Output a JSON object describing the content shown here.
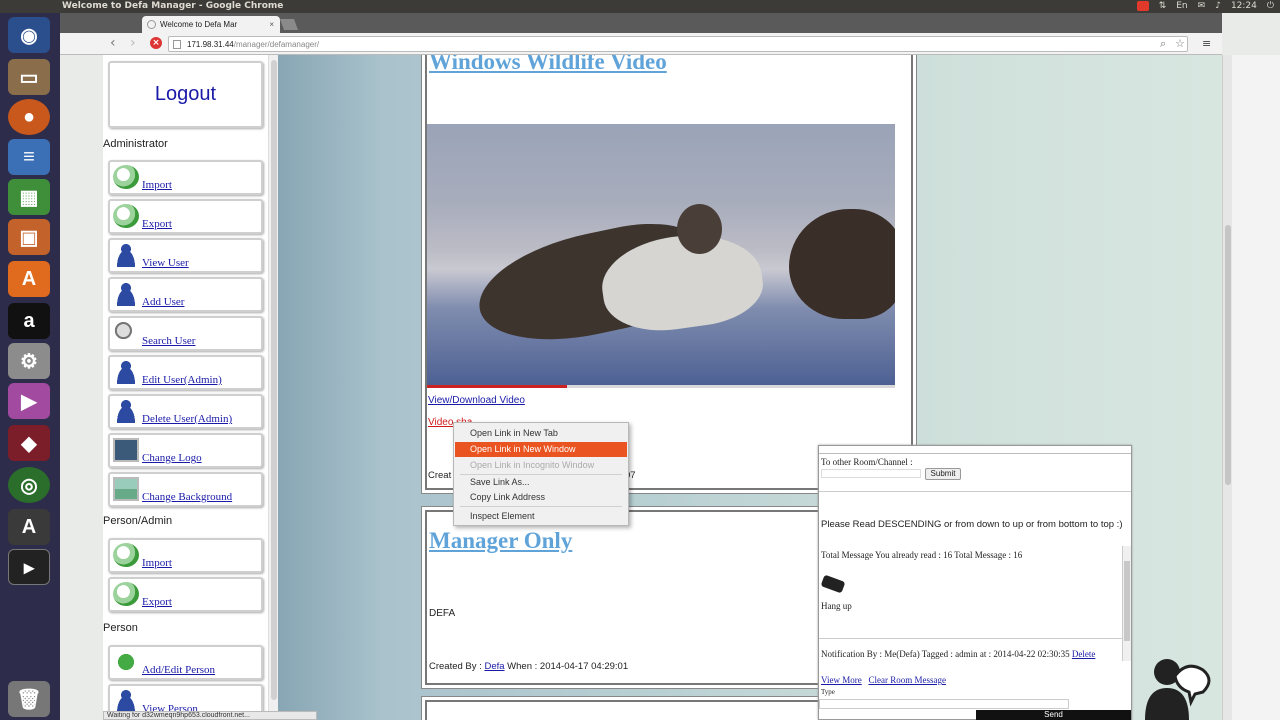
{
  "system": {
    "window_title": "Welcome to Defa Manager - Google Chrome",
    "clock": "12:24",
    "keyboard": "En"
  },
  "browser": {
    "tab_title": "Welcome to Defa Mar",
    "url_host": "171.98.31.44",
    "url_path": "/manager/defamanager/",
    "status_url": "Waiting for d32wmeqn9hp653.cloudfront.net..."
  },
  "sidebar": {
    "logout": "Logout",
    "sections": {
      "administrator": "Administrator",
      "person_admin": "Person/Admin",
      "person": "Person"
    },
    "admin_items": [
      {
        "label": "Import",
        "icon": "import-icon"
      },
      {
        "label": "Export",
        "icon": "export-icon"
      },
      {
        "label": "View User",
        "icon": "user-icon"
      },
      {
        "label": "Add User",
        "icon": "add-user-icon"
      },
      {
        "label": "Search User",
        "icon": "search-user-icon"
      },
      {
        "label": "Edit User(Admin)",
        "icon": "edit-user-icon"
      },
      {
        "label": "Delete User(Admin)",
        "icon": "delete-user-icon"
      },
      {
        "label": "Change Logo",
        "icon": "logo-icon"
      },
      {
        "label": "Change Background",
        "icon": "background-icon"
      }
    ],
    "person_admin_items": [
      {
        "label": "Import",
        "icon": "import-icon"
      },
      {
        "label": "Export",
        "icon": "export-icon"
      }
    ],
    "person_items": [
      {
        "label": "Add/Edit Person",
        "icon": "add-person-icon"
      },
      {
        "label": "View Person",
        "icon": "person-icon"
      }
    ]
  },
  "posts": [
    {
      "title": "Windows Wildlife Video",
      "link1": "View/Download Video",
      "link2": "Video sha",
      "created_prefix": "Creat",
      "created_suffix": "07"
    },
    {
      "title": "Manager Only",
      "body": "DEFA",
      "created_label": "Created By :",
      "author": "Defa",
      "when": "When : 2014-04-17 04:29:01"
    }
  ],
  "context_menu": {
    "items": [
      {
        "label": "Open Link in New Tab",
        "state": "normal"
      },
      {
        "label": "Open Link in New Window",
        "state": "highlighted"
      },
      {
        "label": "Open Link in Incognito Window",
        "state": "disabled"
      },
      {
        "label": "Save Link As...",
        "state": "normal"
      },
      {
        "label": "Copy Link Address",
        "state": "normal"
      },
      {
        "label": "Inspect Element",
        "state": "normal"
      }
    ]
  },
  "chat": {
    "room_label": "To other Room/Channel :",
    "submit": "Submit",
    "instruction": "Please Read DESCENDING or from down to up or from bottom to top :)",
    "totals": "Total Message You already read : 16 Total Message : 16",
    "hangup": "Hang up",
    "notification": "Notification By : Me(Defa) Tagged : admin at : 2014-04-22 02:30:35",
    "delete": "Delete",
    "view_more": "View More",
    "clear_room": "Clear Room Message",
    "type_label": "Type",
    "send": "Send"
  },
  "colors": {
    "accent": "#e95420",
    "link": "#1a1aa8",
    "post_title": "#5fa3d9",
    "launcher_bg": "#2d2c4a"
  }
}
